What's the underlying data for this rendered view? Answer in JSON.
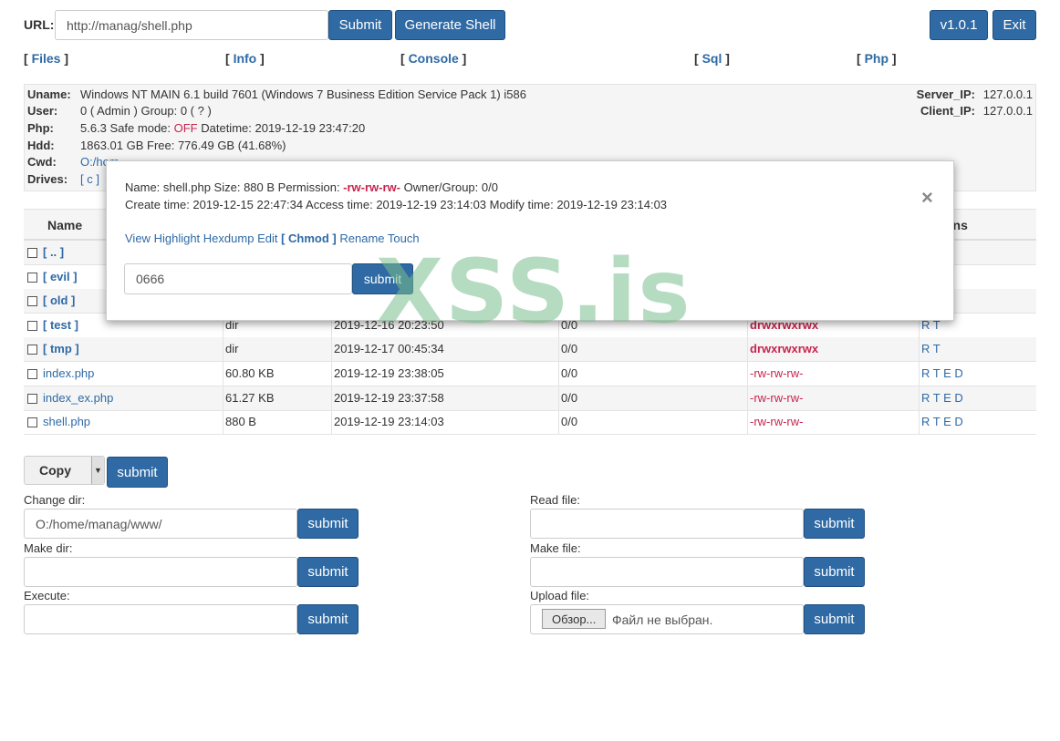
{
  "top": {
    "url_label": "URL:",
    "url_value": "http://manag/shell.php",
    "submit_label": "Submit",
    "generate_label": "Generate Shell",
    "version_label": "v1.0.1",
    "exit_label": "Exit"
  },
  "nav": [
    {
      "label": "Files"
    },
    {
      "label": "Info"
    },
    {
      "label": "Console"
    },
    {
      "label": "Sql"
    },
    {
      "label": "Php"
    }
  ],
  "info": {
    "uname_key": "Uname:",
    "uname_val": "Windows NT MAIN 6.1 build 7601 (Windows 7 Business Edition Service Pack 1) i586",
    "user_key": "User:",
    "user_val": "0 ( Admin ) Group: 0 ( ? )",
    "php_key": "Php:",
    "php_ver": "5.6.3 Safe mode: ",
    "php_safe": "OFF",
    "php_datetime": " Datetime: 2019-12-19 23:47:20",
    "hdd_key": "Hdd:",
    "hdd_val": "1863.01 GB Free: 776.49 GB (41.68%)",
    "cwd_key": "Cwd:",
    "cwd_val": "O:/hom",
    "drives_key": "Drives:",
    "drives_val": "[ c ]",
    "server_ip_key": "Server_IP:",
    "server_ip_val": "127.0.0.1",
    "client_ip_key": "Client_IP:",
    "client_ip_val": "127.0.0.1"
  },
  "table": {
    "headers": {
      "name": "Name",
      "actions": "ons"
    },
    "rows": [
      {
        "name": "[ .. ]",
        "size": "",
        "date": "",
        "owner": "",
        "perm": "",
        "actions": "",
        "is_dir": true
      },
      {
        "name": "[ evil ]",
        "size": "",
        "date": "",
        "owner": "",
        "perm": "",
        "actions": "",
        "is_dir": true
      },
      {
        "name": "[ old ]",
        "size": "",
        "date": "",
        "owner": "",
        "perm": "",
        "actions": "",
        "is_dir": true
      },
      {
        "name": "[ test ]",
        "size": "dir",
        "date": "2019-12-16 20:23:50",
        "owner": "0/0",
        "perm": "drwxrwxrwx",
        "actions": "R T",
        "is_dir": true
      },
      {
        "name": "[ tmp ]",
        "size": "dir",
        "date": "2019-12-17 00:45:34",
        "owner": "0/0",
        "perm": "drwxrwxrwx",
        "actions": "R T",
        "is_dir": true
      },
      {
        "name": "index.php",
        "size": "60.80 KB",
        "date": "2019-12-19 23:38:05",
        "owner": "0/0",
        "perm": "-rw-rw-rw-",
        "actions": "R T E D",
        "is_dir": false
      },
      {
        "name": "index_ex.php",
        "size": "61.27 KB",
        "date": "2019-12-19 23:37:58",
        "owner": "0/0",
        "perm": "-rw-rw-rw-",
        "actions": "R T E D",
        "is_dir": false
      },
      {
        "name": "shell.php",
        "size": "880 B",
        "date": "2019-12-19 23:14:03",
        "owner": "0/0",
        "perm": "-rw-rw-rw-",
        "actions": "R T E D",
        "is_dir": false
      }
    ]
  },
  "bottom": {
    "copy_select": "Copy",
    "submit": "submit",
    "change_dir_label": "Change dir:",
    "change_dir_value": "O:/home/manag/www/",
    "make_dir_label": "Make dir:",
    "execute_label": "Execute:",
    "read_file_label": "Read file:",
    "make_file_label": "Make file:",
    "upload_file_label": "Upload file:",
    "browse_label": "Обзор...",
    "no_file_label": "Файл не выбран."
  },
  "modal": {
    "line1_prefix": "Name: shell.php Size: 880 B Permission: ",
    "line1_perm": "-rw-rw-rw-",
    "line1_suffix": " Owner/Group: 0/0",
    "line2": "Create time: 2019-12-15 22:47:34 Access time: 2019-12-19 23:14:03 Modify time: 2019-12-19 23:14:03",
    "actions": {
      "view": "View",
      "highlight": "Highlight",
      "hexdump": "Hexdump",
      "edit": "Edit",
      "chmod": "[ Chmod ]",
      "rename": "Rename",
      "touch": "Touch"
    },
    "chmod_value": "0666",
    "submit": "submit",
    "close": "×"
  },
  "watermark": "XSS.is",
  "colors": {
    "accent": "#2f6aa5",
    "danger": "#c7254e"
  }
}
